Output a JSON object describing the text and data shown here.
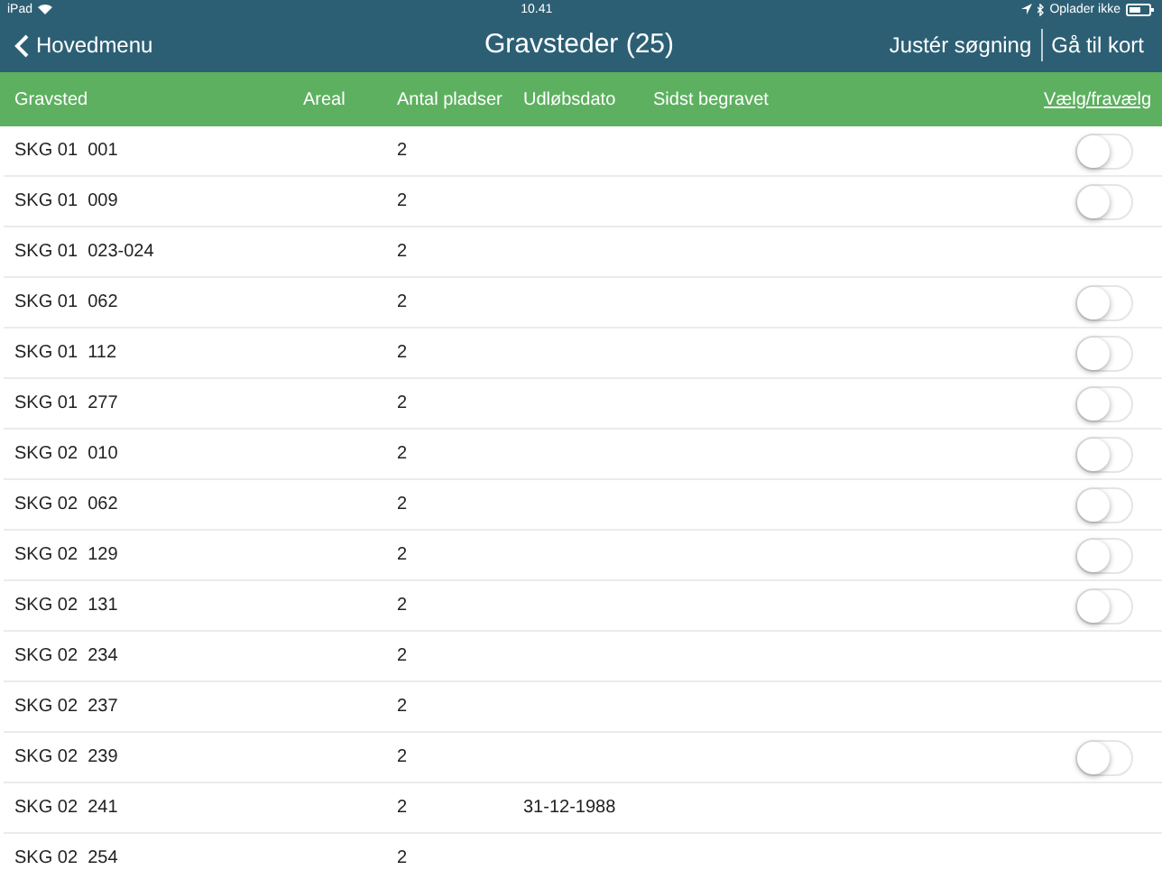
{
  "status_bar": {
    "device": "iPad",
    "time": "10.41",
    "charging": "Oplader ikke"
  },
  "nav": {
    "back": "Hovedmenu",
    "title": "Gravsteder (25)",
    "actions": [
      "Justér søgning",
      "Gå til kort"
    ]
  },
  "table": {
    "columns": [
      "Gravsted",
      "Areal",
      "Antal pladser",
      "Udløbsdato",
      "Sidst begravet"
    ],
    "select_link": "Vælg/fravælg",
    "rows": [
      {
        "gravsted": "SKG 01  001",
        "pladser": "2",
        "switch_on": false
      },
      {
        "gravsted": "SKG 01  009",
        "pladser": "2",
        "switch_on": false
      },
      {
        "gravsted": "SKG 01  023-024",
        "pladser": "2"
      },
      {
        "gravsted": "SKG 01  062",
        "pladser": "2",
        "switch_on": false
      },
      {
        "gravsted": "SKG 01  112",
        "pladser": "2",
        "switch_on": false
      },
      {
        "gravsted": "SKG 01  277",
        "pladser": "2",
        "switch_on": false
      },
      {
        "gravsted": "SKG 02  010",
        "pladser": "2",
        "switch_on": false
      },
      {
        "gravsted": "SKG 02  062",
        "pladser": "2",
        "switch_on": false
      },
      {
        "gravsted": "SKG 02  129",
        "pladser": "2",
        "switch_on": false
      },
      {
        "gravsted": "SKG 02  131",
        "pladser": "2",
        "switch_on": false
      },
      {
        "gravsted": "SKG 02  234",
        "pladser": "2"
      },
      {
        "gravsted": "SKG 02  237",
        "pladser": "2"
      },
      {
        "gravsted": "SKG 02  239",
        "pladser": "2",
        "switch_on": false
      },
      {
        "gravsted": "SKG 02  241",
        "pladser": "2",
        "udlobsdato": "31-12-1988"
      },
      {
        "gravsted": "SKG 02  254",
        "pladser": "2"
      }
    ]
  }
}
